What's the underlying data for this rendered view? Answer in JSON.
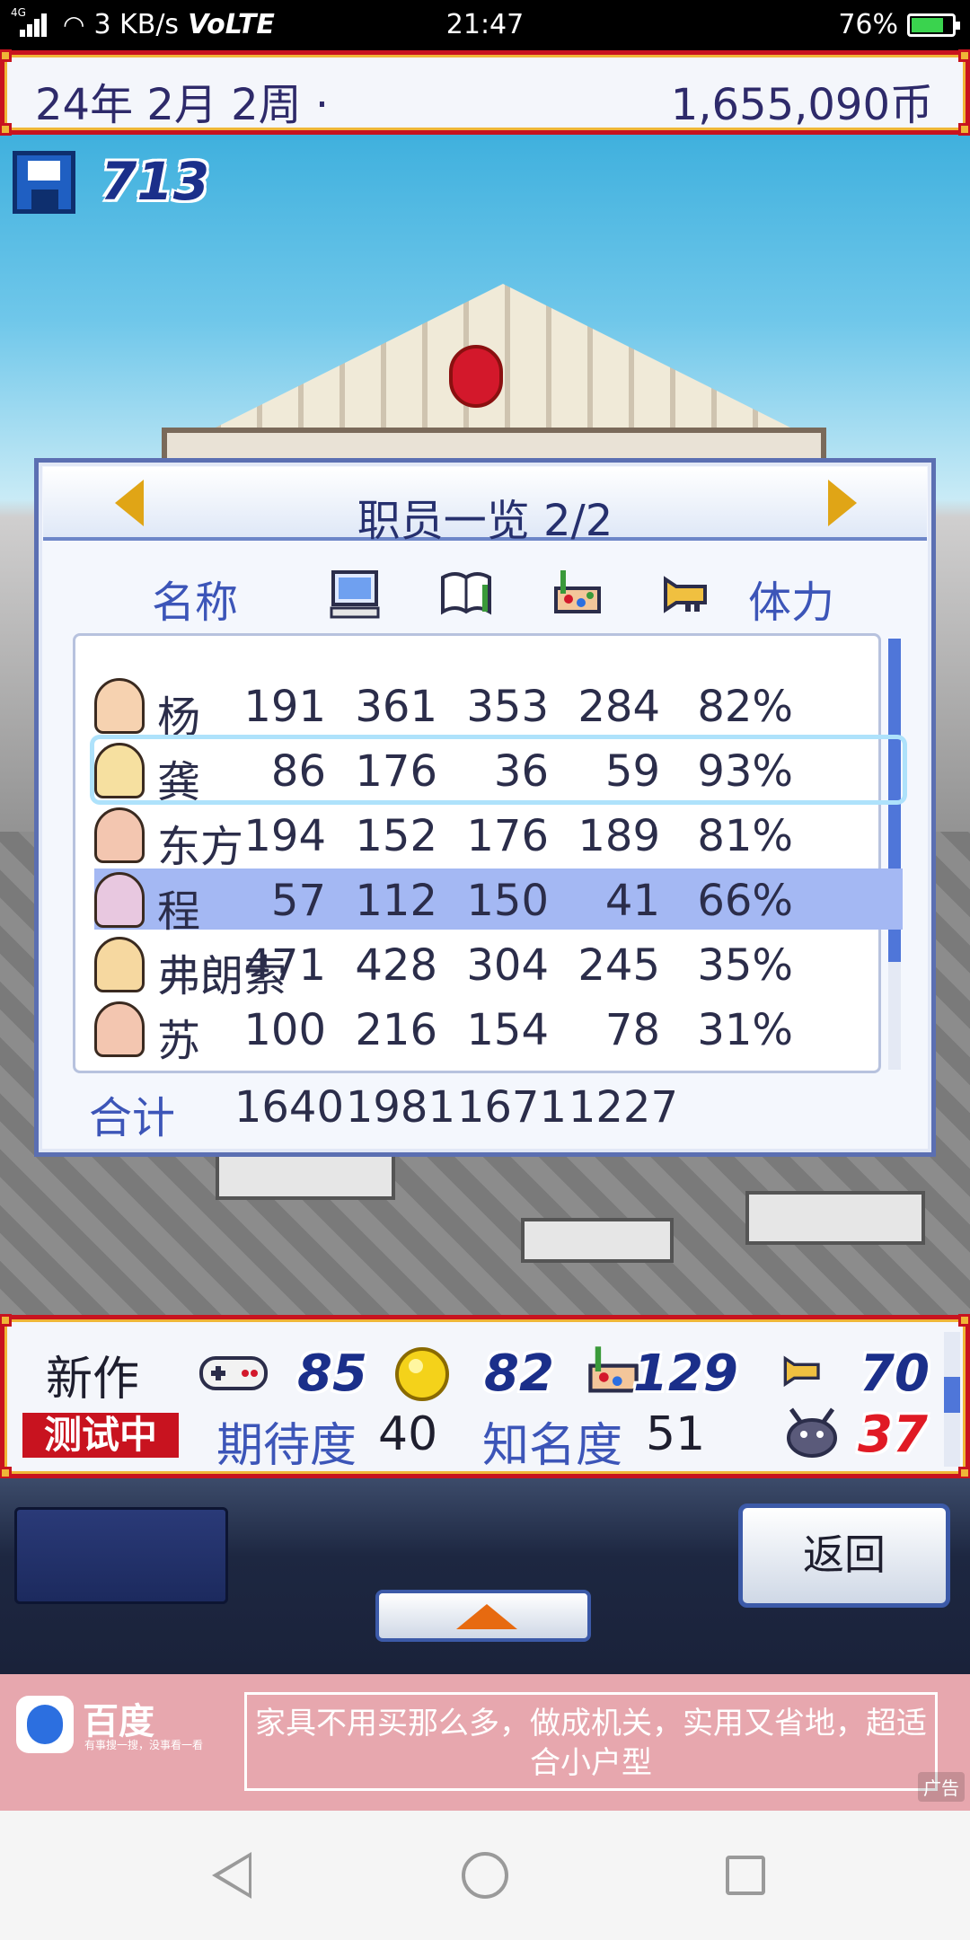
{
  "status_bar": {
    "network": "4G",
    "speed": "3 KB/s",
    "volte": "VoLTE",
    "time": "21:47",
    "battery": "76%",
    "battery_level": 0.76
  },
  "top_bar": {
    "date": "24年 2月 2周 ·",
    "money": "1,655,090币"
  },
  "save": {
    "icon": "floppy-disk-icon",
    "count": "713"
  },
  "staff_panel": {
    "title": "职员一览 2/2",
    "prev_icon": "arrow-left-icon",
    "next_icon": "arrow-right-icon",
    "columns": {
      "name": "名称",
      "icons": [
        "computer-icon",
        "book-icon",
        "paint-icon",
        "trumpet-icon"
      ],
      "stamina": "体力"
    },
    "rows": [
      {
        "name": "杨",
        "v1": "191",
        "v2": "361",
        "v3": "353",
        "v4": "284",
        "stamina": "82%"
      },
      {
        "name": "龚",
        "v1": "86",
        "v2": "176",
        "v3": "36",
        "v4": "59",
        "stamina": "93%"
      },
      {
        "name": "东方",
        "v1": "194",
        "v2": "152",
        "v3": "176",
        "v4": "189",
        "stamina": "81%"
      },
      {
        "name": "程",
        "v1": "57",
        "v2": "112",
        "v3": "150",
        "v4": "41",
        "stamina": "66%"
      },
      {
        "name": "弗朗索",
        "v1": "471",
        "v2": "428",
        "v3": "304",
        "v4": "245",
        "stamina": "35%"
      },
      {
        "name": "苏",
        "v1": "100",
        "v2": "216",
        "v3": "154",
        "v4": "78",
        "stamina": "31%"
      }
    ],
    "total": {
      "label": "合计",
      "v1": "1640",
      "v2": "1981",
      "v3": "1671",
      "v4": "1227"
    }
  },
  "game_bar": {
    "title": "新作",
    "status": "测试中",
    "stat1": "85",
    "stat2": "82",
    "stat3": "129",
    "stat4": "70",
    "expectation_label": "期待度",
    "expectation": "40",
    "fame_label": "知名度",
    "fame": "51",
    "bug_count": "37"
  },
  "controls": {
    "back": "返回"
  },
  "ad": {
    "brand": "百度",
    "slogan": "有事搜一搜，没事看一看",
    "text": "家具不用买那么多，做成机关，实用又省地，超适合小户型",
    "tag": "广告"
  },
  "colors": {
    "frame_red": "#c8131f",
    "frame_gold": "#f0b637",
    "header_blue": "#3c55b8",
    "selected_row": "#a4b8f3"
  }
}
